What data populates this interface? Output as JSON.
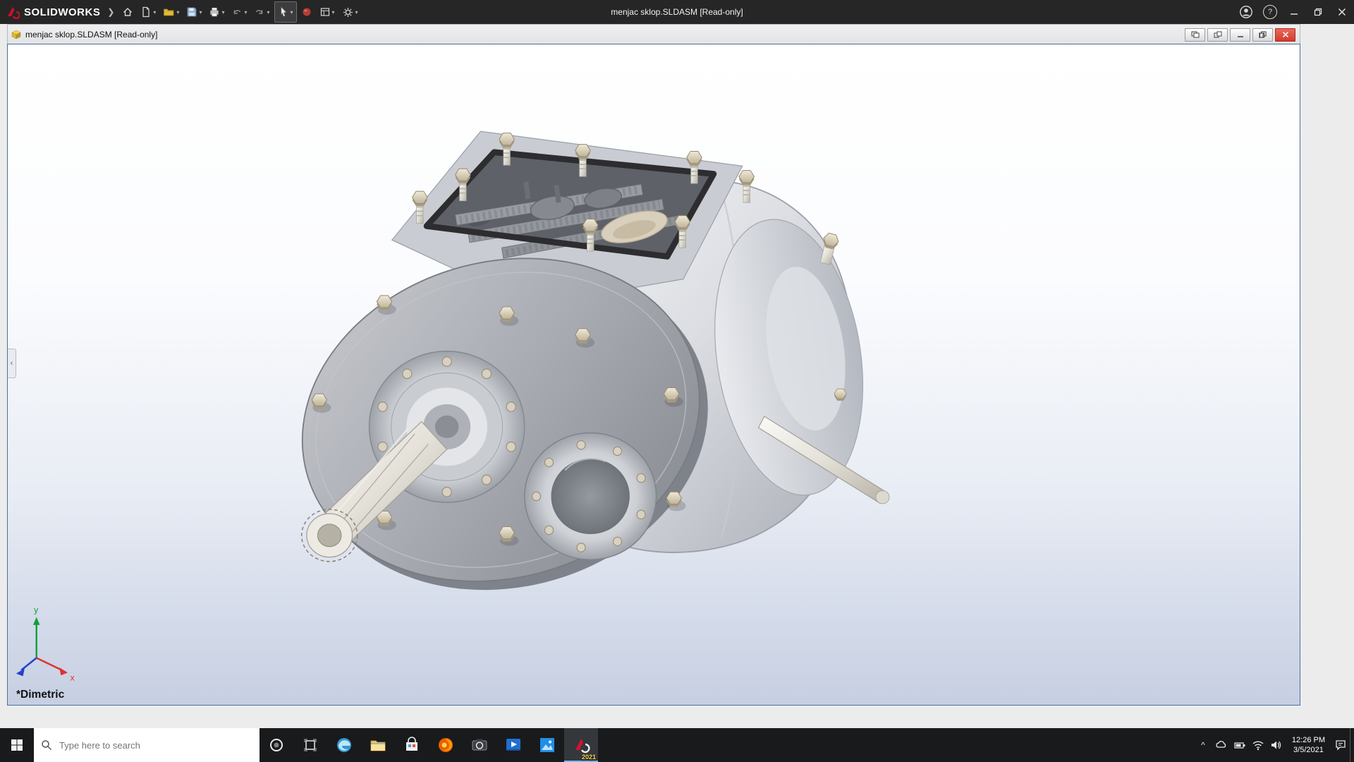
{
  "app": {
    "brand": "SOLIDWORKS",
    "title": "menjac sklop.SLDASM [Read-only]"
  },
  "doc": {
    "title": "menjac sklop.SLDASM [Read-only]"
  },
  "viewport": {
    "orientation_label": "*Dimetric",
    "triad_x": "x",
    "triad_y": "y"
  },
  "taskbar": {
    "search_placeholder": "Type here to search",
    "sw_badge": "2021",
    "time": "12:26 PM",
    "date": "3/5/2021"
  },
  "icons": {
    "caret": "▾",
    "help": "?",
    "chevron_left": "‹",
    "chevron_up": "^"
  },
  "colors": {
    "accent_blue_border": "#49719f",
    "close_red": "#d33b2c",
    "titlebar_dark": "#262626",
    "bolt_tan": "#d9cfb8"
  }
}
